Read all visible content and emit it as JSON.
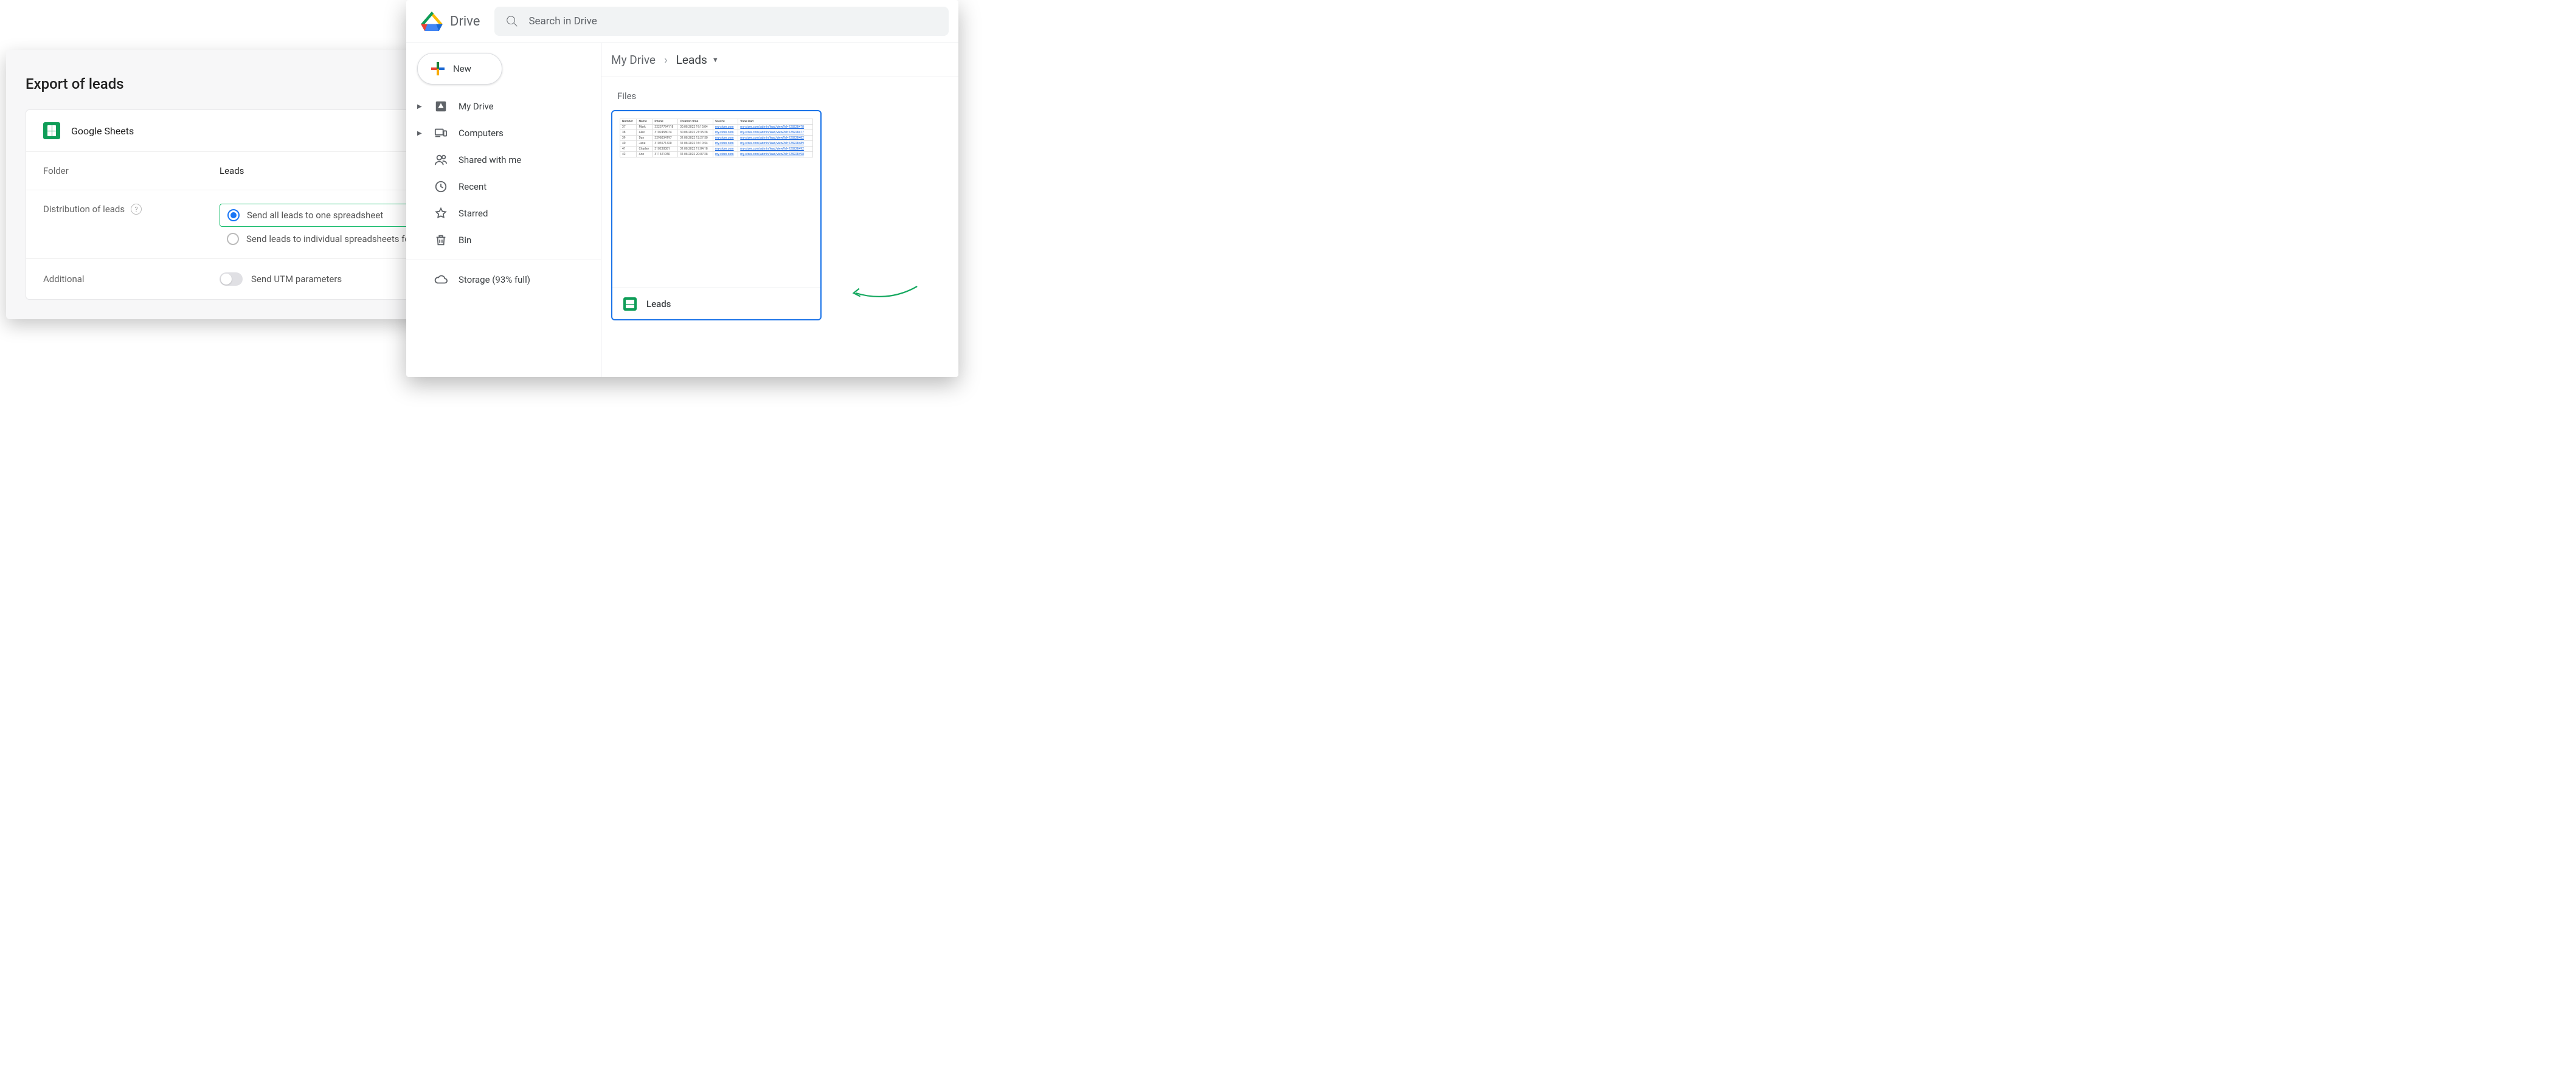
{
  "export": {
    "title": "Export of leads",
    "integration_label": "Google Sheets",
    "folder_label": "Folder",
    "folder_value": "Leads",
    "dist_label": "Distribution of leads",
    "radio_all": "Send all leads to one spreadsheet",
    "radio_each": "Send leads to individual spreadsheets for each form",
    "additional_label": "Additional",
    "utm_label": "Send UTM parameters"
  },
  "drive": {
    "brand": "Drive",
    "search_placeholder": "Search in Drive",
    "new_label": "New",
    "side": {
      "mydrive": "My Drive",
      "computers": "Computers",
      "shared": "Shared with me",
      "recent": "Recent",
      "starred": "Starred",
      "bin": "Bin",
      "storage": "Storage (93% full)"
    },
    "breadcrumb": {
      "root": "My Drive",
      "current": "Leads"
    },
    "files_title": "Files",
    "file_name": "Leads",
    "preview": {
      "cols": [
        "Number",
        "Name",
        "Phone",
        "Creation time",
        "Source",
        "View lead"
      ],
      "rows": [
        [
          "37",
          "Mark",
          "32237794118",
          "30.08.2022 19:15:04",
          "my-store.com",
          "my-store.com/admin/lead/view?id=128228478"
        ],
        [
          "38",
          "Alex",
          "3102458074",
          "30.08.2022 21:35:28",
          "my-store.com",
          "my-store.com/admin/lead/view?id=128228477"
        ],
        [
          "39",
          "Dan",
          "3298034197",
          "31.08.2022 12:27:50",
          "my-store.com",
          "my-store.com/admin/lead/view?id=128228482"
        ],
        [
          "40",
          "Jane",
          "3103571420",
          "31.08.2022 16:10:54",
          "my-store.com",
          "my-store.com/admin/lead/view?id=128228489"
        ],
        [
          "41",
          "Charley",
          "310230081",
          "31.08.2022 17:04:18",
          "my-store.com",
          "my-store.com/admin/lead/view?id=128228492"
        ],
        [
          "42",
          "Ann",
          "311421050",
          "31.08.2022 20:07:28",
          "my-store.com",
          "my-store.com/admin/lead/view?id=128228498"
        ]
      ]
    }
  }
}
